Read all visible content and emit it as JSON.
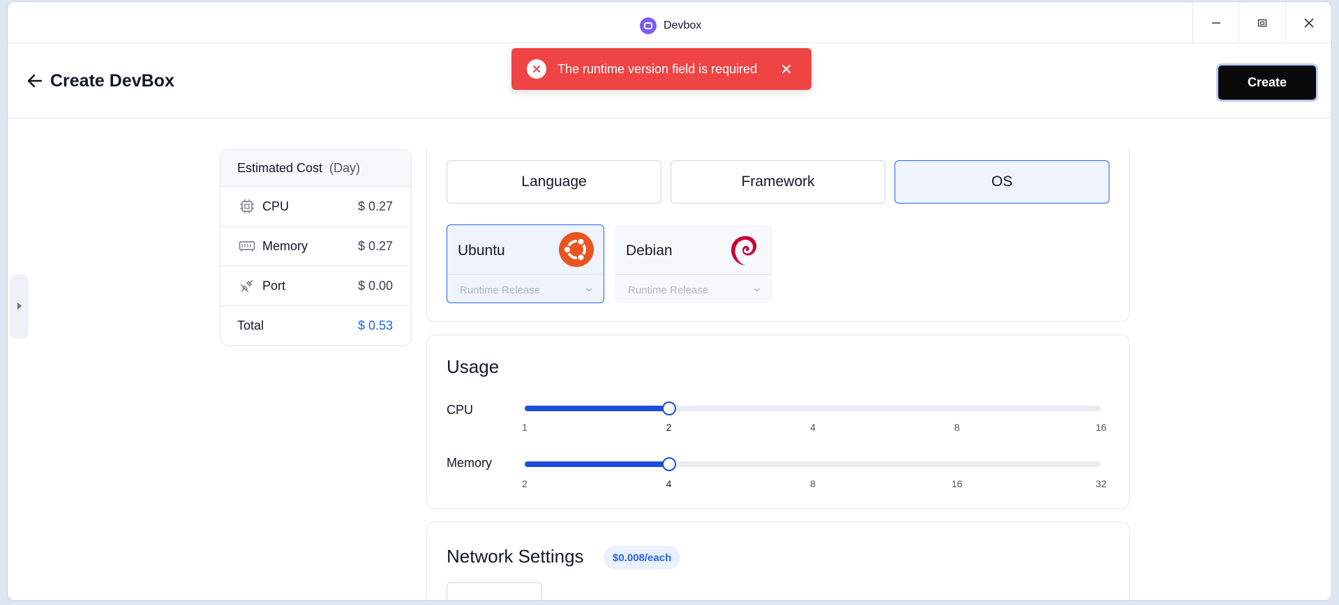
{
  "app": {
    "title": "Devbox",
    "accent": "#7c5cf5"
  },
  "header": {
    "title": "Create DevBox",
    "create_label": "Create"
  },
  "toast": {
    "message": "The runtime version field is required",
    "color": "#ef4444"
  },
  "cost": {
    "title": "Estimated Cost",
    "unit": "(Day)",
    "rows": [
      {
        "label": "CPU",
        "value": "$ 0.27",
        "icon": "cpu-icon"
      },
      {
        "label": "Memory",
        "value": "$ 0.27",
        "icon": "memory-icon"
      },
      {
        "label": "Port",
        "value": "$ 0.00",
        "icon": "port-icon"
      }
    ],
    "total_label": "Total",
    "total_value": "$ 0.53"
  },
  "runtime": {
    "tabs": [
      "Language",
      "Framework",
      "OS"
    ],
    "active_tab": "OS",
    "options": [
      {
        "name": "Ubuntu",
        "placeholder": "Runtime Release",
        "selected": true,
        "icon": "ubuntu-logo-icon"
      },
      {
        "name": "Debian",
        "placeholder": "Runtime Release",
        "selected": false,
        "icon": "debian-logo-icon"
      }
    ]
  },
  "usage": {
    "title": "Usage",
    "cpu": {
      "label": "CPU",
      "ticks": [
        "1",
        "2",
        "4",
        "8",
        "16"
      ],
      "selected_index": 1
    },
    "memory": {
      "label": "Memory",
      "ticks": [
        "2",
        "4",
        "8",
        "16",
        "32"
      ],
      "selected_index": 1
    },
    "accent": "#1d4ed8"
  },
  "network": {
    "title": "Network Settings",
    "price_badge": "$0.008/each"
  }
}
